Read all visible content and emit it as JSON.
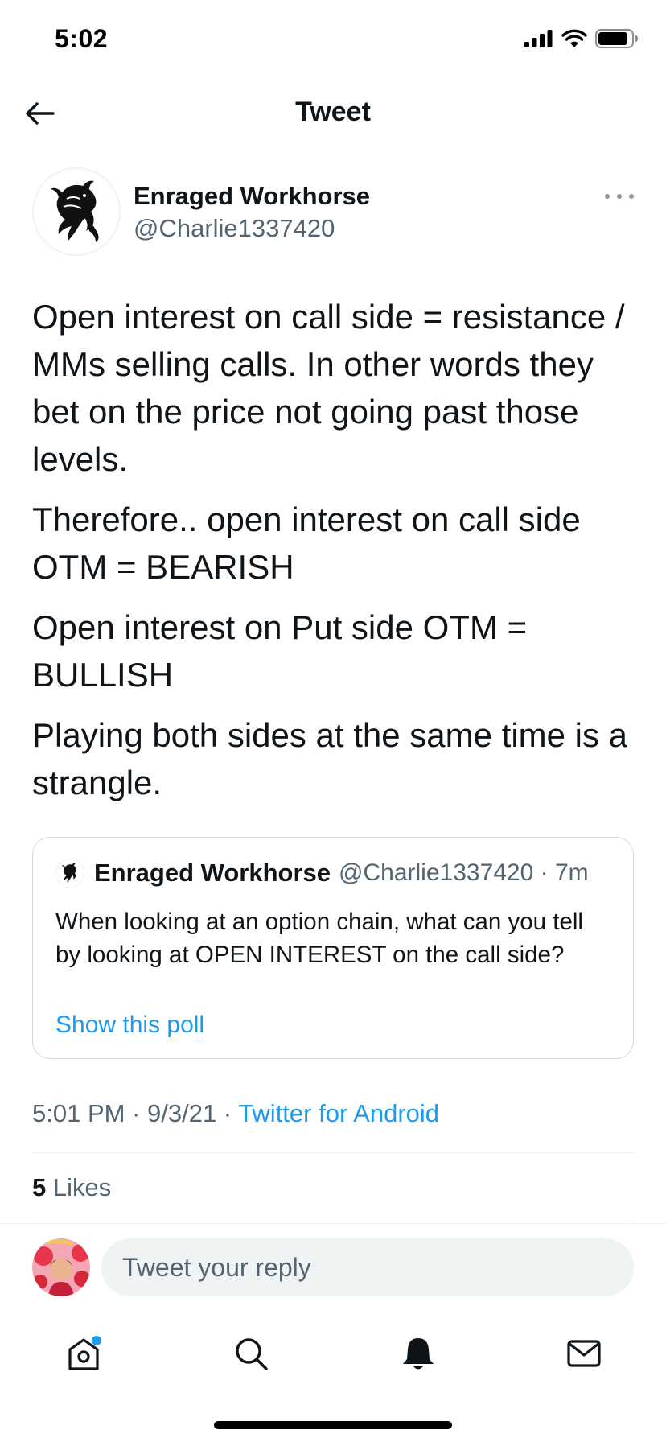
{
  "status_bar": {
    "time": "5:02"
  },
  "header": {
    "title": "Tweet"
  },
  "tweet": {
    "author_name": "Enraged Workhorse",
    "author_handle": "@Charlie1337420",
    "paragraphs": [
      "Open interest on call side = resistance / MMs selling calls. In other words they bet on the price not going past those levels.",
      "Therefore.. open interest on call side OTM = BEARISH",
      "Open interest on Put side OTM = BULLISH",
      "Playing both sides at the same time is a strangle."
    ],
    "quote": {
      "author_name": "Enraged Workhorse",
      "handle_time": "@Charlie1337420 · 7m",
      "text": "When looking at an option chain, what can you tell by looking at OPEN INTEREST on the call side?",
      "link": "Show this poll"
    },
    "meta_time": "5:01 PM · 9/3/21 · ",
    "meta_source": "Twitter for Android",
    "likes_count": "5",
    "likes_label": " Likes"
  },
  "reply": {
    "placeholder": "Tweet your reply"
  },
  "tab_bar": {
    "items": [
      "home-icon",
      "search-icon",
      "bell-icon",
      "mail-icon"
    ],
    "notification_dot": true
  },
  "colors": {
    "accent": "#1d9bf0",
    "text_primary": "#0f1419",
    "text_secondary": "#536471",
    "divider": "#eff3f4"
  }
}
